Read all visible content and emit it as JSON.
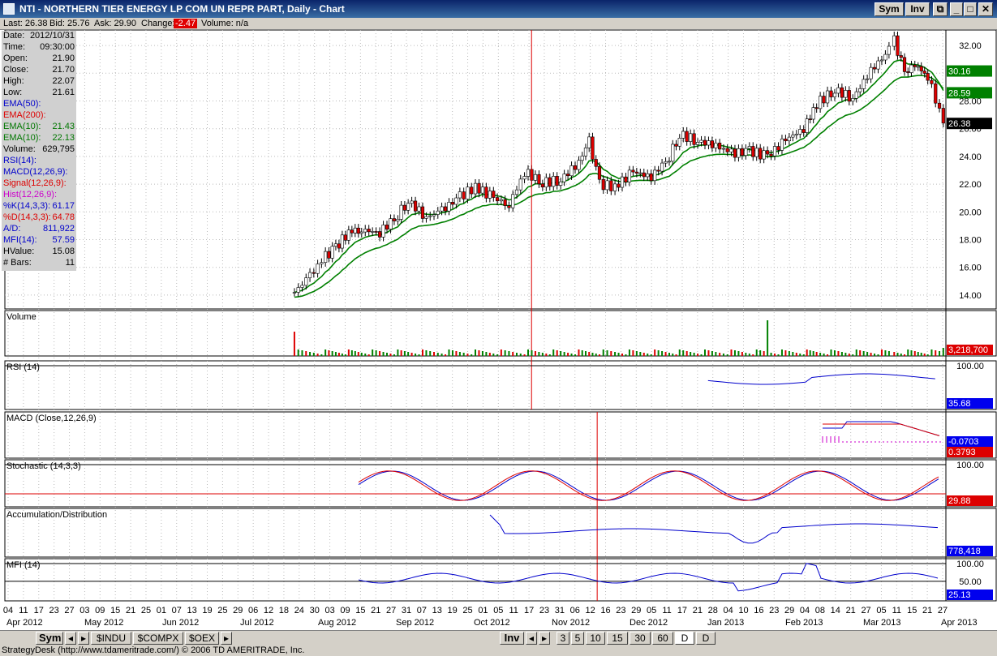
{
  "window": {
    "title": "NTI - NORTHERN TIER ENERGY LP COM UN REPR PART, Daily - Chart",
    "btn_sym": "Sym",
    "btn_inv": "Inv"
  },
  "quote": {
    "last": "Last: 26.38",
    "bid": "Bid: 25.76",
    "ask": "Ask: 29.90",
    "change_label": "Change:",
    "change_value": "-2.47",
    "volume": "Volume: n/a"
  },
  "data_panel": [
    {
      "k": "Date:",
      "v": "2012/10/31",
      "color": "#000000"
    },
    {
      "k": "Time:",
      "v": "09:30:00",
      "color": "#000000"
    },
    {
      "k": "Open:",
      "v": "21.90",
      "color": "#000000"
    },
    {
      "k": "Close:",
      "v": "21.70",
      "color": "#000000"
    },
    {
      "k": "High:",
      "v": "22.07",
      "color": "#000000"
    },
    {
      "k": "Low:",
      "v": "21.61",
      "color": "#000000"
    },
    {
      "k": "EMA(50):",
      "v": "",
      "color": "#0000cc"
    },
    {
      "k": "EMA(200):",
      "v": "",
      "color": "#dd0000"
    },
    {
      "k": "EMA(10):",
      "v": "21.43",
      "color": "#007700"
    },
    {
      "k": "EMA(10):",
      "v": "22.13",
      "color": "#007700"
    },
    {
      "k": "Volume:",
      "v": "629,795",
      "color": "#000000"
    },
    {
      "k": "RSI(14):",
      "v": "",
      "color": "#0000cc"
    },
    {
      "k": "MACD(12,26,9):",
      "v": "",
      "color": "#0000cc"
    },
    {
      "k": "Signal(12,26,9):",
      "v": "",
      "color": "#dd0000"
    },
    {
      "k": "Hist(12,26,9):",
      "v": "",
      "color": "#cc00cc"
    },
    {
      "k": "%K(14,3,3):",
      "v": "61.17",
      "color": "#0000cc"
    },
    {
      "k": "%D(14,3,3):",
      "v": "64.78",
      "color": "#dd0000"
    },
    {
      "k": "A/D:",
      "v": "811,922",
      "color": "#0000cc"
    },
    {
      "k": "MFI(14):",
      "v": "57.59",
      "color": "#0000cc"
    },
    {
      "k": "HValue:",
      "v": "15.08",
      "color": "#000000"
    },
    {
      "k": "# Bars:",
      "v": "11",
      "color": "#000000"
    }
  ],
  "chart_data": {
    "type": "candlestick",
    "x_range": [
      "2012-04-04",
      "2013-04-03"
    ],
    "price_ylim": [
      13,
      33
    ],
    "price_ticks": [
      "32.00",
      "30.00",
      "28.00",
      "26.00",
      "24.00",
      "22.00",
      "20.00",
      "18.00",
      "16.00",
      "14.00"
    ],
    "price_tick_values": [
      32,
      30,
      28,
      26,
      24,
      22,
      20,
      18,
      16,
      14
    ],
    "right_labels": [
      {
        "text": "30.16",
        "value": 30.16,
        "color": "#008000"
      },
      {
        "text": "28.59",
        "value": 28.59,
        "color": "#008000"
      },
      {
        "text": "26.38",
        "value": 26.38,
        "color": "#000000"
      }
    ],
    "close_points": [
      [
        "2012-07-25",
        14.2
      ],
      [
        "2012-07-31",
        15.4
      ],
      [
        "2012-08-06",
        16.8
      ],
      [
        "2012-08-10",
        17.4
      ],
      [
        "2012-08-15",
        18.6
      ],
      [
        "2012-08-20",
        18.7
      ],
      [
        "2012-08-27",
        18.5
      ],
      [
        "2012-09-03",
        19.8
      ],
      [
        "2012-09-07",
        20.8
      ],
      [
        "2012-09-14",
        19.6
      ],
      [
        "2012-09-20",
        20.1
      ],
      [
        "2012-09-27",
        21.1
      ],
      [
        "2012-10-03",
        21.8
      ],
      [
        "2012-10-10",
        21.0
      ],
      [
        "2012-10-16",
        20.5
      ],
      [
        "2012-10-22",
        22.9
      ],
      [
        "2012-10-29",
        22.1
      ],
      [
        "2012-11-05",
        22.3
      ],
      [
        "2012-11-12",
        23.6
      ],
      [
        "2012-11-16",
        25.1
      ],
      [
        "2012-11-20",
        22.0
      ],
      [
        "2012-11-26",
        21.8
      ],
      [
        "2012-12-03",
        22.9
      ],
      [
        "2012-12-10",
        22.5
      ],
      [
        "2012-12-17",
        24.0
      ],
      [
        "2012-12-21",
        25.6
      ],
      [
        "2012-12-28",
        25.1
      ],
      [
        "2013-01-04",
        24.8
      ],
      [
        "2013-01-10",
        24.2
      ],
      [
        "2013-01-17",
        24.4
      ],
      [
        "2013-01-24",
        24.0
      ],
      [
        "2013-01-31",
        25.2
      ],
      [
        "2013-02-07",
        26.0
      ],
      [
        "2013-02-12",
        27.8
      ],
      [
        "2013-02-19",
        28.8
      ],
      [
        "2013-02-26",
        28.2
      ],
      [
        "2013-03-05",
        30.2
      ],
      [
        "2013-03-12",
        31.6
      ],
      [
        "2013-03-14",
        32.4
      ],
      [
        "2013-03-18",
        30.0
      ],
      [
        "2013-03-22",
        30.6
      ],
      [
        "2013-03-27",
        29.8
      ],
      [
        "2013-04-02",
        26.4
      ]
    ],
    "x_ticks": [
      "04",
      "11",
      "17",
      "23",
      "27",
      "03",
      "09",
      "15",
      "21",
      "25",
      "01",
      "07",
      "13",
      "19",
      "25",
      "29",
      "06",
      "12",
      "18",
      "24",
      "30",
      "03",
      "09",
      "15",
      "21",
      "27",
      "31",
      "07",
      "13",
      "19",
      "25",
      "01",
      "05",
      "11",
      "17",
      "23",
      "31",
      "06",
      "12",
      "16",
      "23",
      "29",
      "05",
      "11",
      "17",
      "21",
      "28",
      "04",
      "10",
      "16",
      "23",
      "29",
      "04",
      "08",
      "14",
      "21",
      "27",
      "05",
      "11",
      "15",
      "21",
      "27"
    ],
    "month_labels": [
      "Apr 2012",
      "May 2012",
      "Jun 2012",
      "Jul 2012",
      "Aug 2012",
      "Sep 2012",
      "Oct 2012",
      "Nov 2012",
      "Dec 2012",
      "Jan 2013",
      "Feb 2013",
      "Mar 2013",
      "Apr 2013"
    ],
    "panels": [
      {
        "title": "Volume",
        "right_value": "3,218,700",
        "right_color": "#dd0000",
        "ticks": []
      },
      {
        "title": "RSI (14)",
        "right_value": "35.68",
        "right_color": "#0000ee",
        "ticks": [
          "100.00"
        ]
      },
      {
        "title": "MACD (Close,12,26,9)",
        "right_value": "0.3793",
        "right_color": "#dd0000",
        "second_value": "-0.0703",
        "second_color": "#0000ee",
        "ticks": []
      },
      {
        "title": "Stochastic (14,3,3)",
        "right_value": "29.88",
        "right_color": "#dd0000",
        "ticks": [
          "100.00"
        ]
      },
      {
        "title": "Accumulation/Distribution",
        "right_value": "778,418",
        "right_color": "#0000ee",
        "ticks": []
      },
      {
        "title": "MFI (14)",
        "right_value": "25.13",
        "right_color": "#0000ee",
        "ticks": [
          "100.00",
          "50.00"
        ]
      }
    ]
  },
  "bottom_tabs_left": [
    "Sym",
    "$INDU",
    "$COMPX",
    "$OEX"
  ],
  "bottom_tabs_right": [
    "Inv",
    "3",
    "5",
    "10",
    "15",
    "30",
    "60",
    "D",
    "D"
  ],
  "status": "StrategyDesk (http://www.tdameritrade.com/) © 2006 TD AMERITRADE, Inc."
}
